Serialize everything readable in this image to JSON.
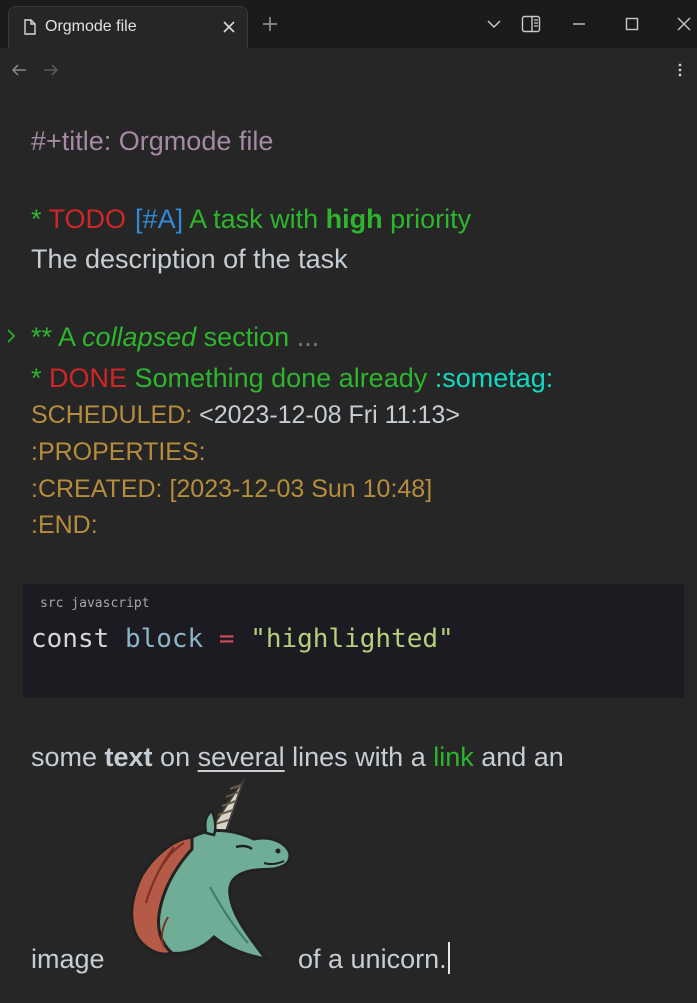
{
  "window": {
    "tab_title": "Orgmode file",
    "icons": [
      "file-icon",
      "close-icon",
      "plus-icon",
      "chevron-down-icon",
      "sidebar-toggle-icon",
      "minimize-icon",
      "maximize-icon",
      "close-window-icon",
      "back-arrow-icon",
      "forward-arrow-icon",
      "kebab-menu-icon"
    ]
  },
  "doc": {
    "title_line": "#+title: Orgmode file",
    "heading1": {
      "stars": "* ",
      "keyword": "TODO",
      "priority": "[#A]",
      "text_before": " A task with ",
      "bold": "high",
      "text_after": " priority"
    },
    "description": "The description of the task",
    "heading2": {
      "stars": "** A ",
      "italic": "collapsed",
      "text_after": " section ",
      "ellipsis": "..."
    },
    "heading3": {
      "stars": "* ",
      "keyword": "DONE",
      "text": " Something done already ",
      "tag": ":sometag:"
    },
    "scheduled_label": "SCHEDULED:",
    "scheduled_value": " <2023-12-08 Fri 11:13>",
    "properties_line": ":PROPERTIES:",
    "created_line": ":CREATED: [2023-12-03 Sun 10:48]",
    "end_line": ":END:",
    "src_label": "src javascript",
    "code": {
      "kw": "const",
      "var": "block",
      "op": "=",
      "str": "\"highlighted\""
    },
    "para1": {
      "a": "some ",
      "bold": "text",
      "b": " on ",
      "underline": "several",
      "c": " lines with a ",
      "link": "link",
      "d": " and an"
    },
    "para2": {
      "a": "image",
      "b": "of a unicorn."
    }
  },
  "colors": {
    "background": "#262626",
    "heading": "#2db52d",
    "todo": "#cf2727",
    "priority": "#2f8bd6",
    "tag": "#13d8c2",
    "meta": "#b58d3c",
    "title_meta": "#a48aa4"
  }
}
